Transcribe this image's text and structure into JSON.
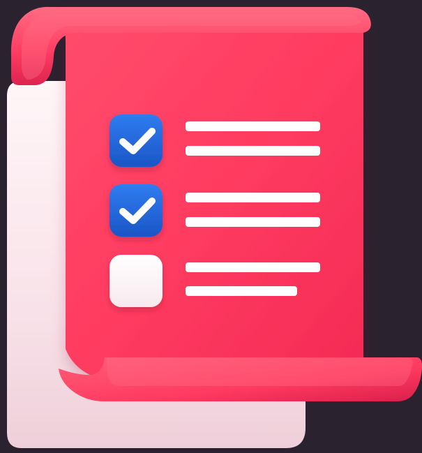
{
  "scene": {
    "background": "#2b2230",
    "back_sheet_color": "#f7e3ea",
    "scroll_color": "#ff3e63",
    "scroll_dark_color": "#d41f4a",
    "checkbox_checked_color": "#1f66d8",
    "checkbox_empty_color": "#fff1f4",
    "checkmark_icon": "check-icon"
  },
  "checklist": {
    "items": [
      {
        "checked": true
      },
      {
        "checked": true
      },
      {
        "checked": false
      }
    ]
  }
}
